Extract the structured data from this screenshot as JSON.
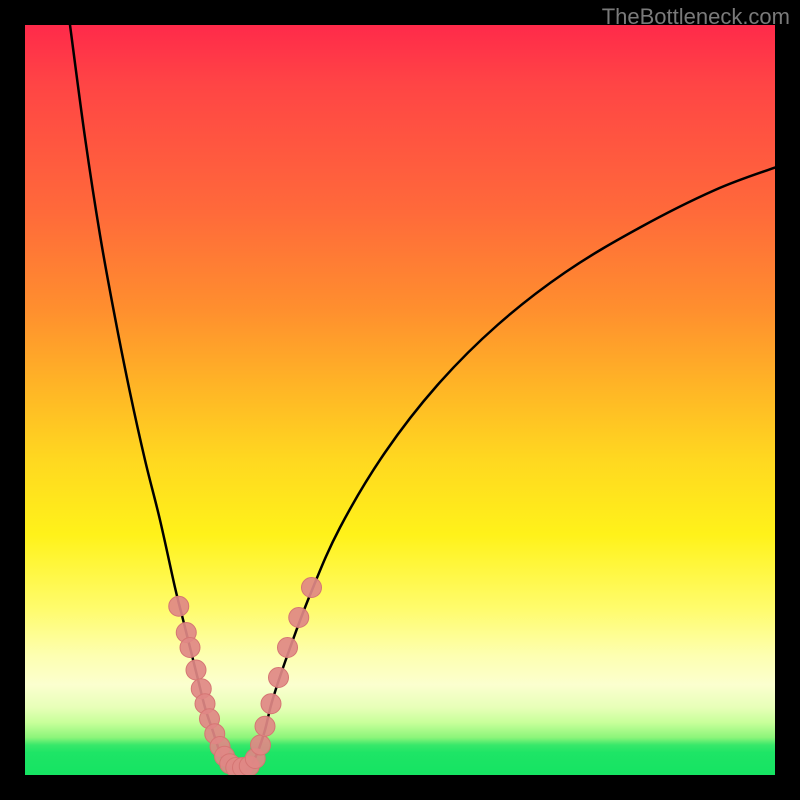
{
  "watermark": "TheBottleneck.com",
  "colors": {
    "frame": "#000000",
    "curve": "#000000",
    "marker_fill": "#e08886",
    "marker_stroke": "#d57573"
  },
  "chart_data": {
    "type": "line",
    "title": "",
    "xlabel": "",
    "ylabel": "",
    "xlim": [
      0,
      100
    ],
    "ylim": [
      0,
      100
    ],
    "series": [
      {
        "name": "left-branch",
        "x": [
          6,
          8,
          10,
          12,
          14,
          16,
          18,
          20,
          21,
          22,
          23,
          24,
          25,
          26,
          27
        ],
        "y": [
          100,
          85,
          72,
          61,
          51,
          42,
          34,
          25,
          21,
          17,
          13,
          9,
          6,
          3,
          1
        ]
      },
      {
        "name": "right-branch",
        "x": [
          30,
          31,
          32,
          33,
          35,
          38,
          42,
          48,
          55,
          63,
          72,
          82,
          92,
          100
        ],
        "y": [
          1,
          3,
          6,
          10,
          16,
          24,
          33,
          43,
          52,
          60,
          67,
          73,
          78,
          81
        ]
      },
      {
        "name": "valley-floor",
        "x": [
          27,
          28,
          29,
          30
        ],
        "y": [
          1,
          0.5,
          0.5,
          1
        ]
      }
    ],
    "markers": {
      "name": "highlight-points",
      "x": [
        20.5,
        21.5,
        22.0,
        22.8,
        23.5,
        24.0,
        24.6,
        25.3,
        26.0,
        26.6,
        27.3,
        28.1,
        29.0,
        29.9,
        30.7,
        31.4,
        32.0,
        32.8,
        33.8,
        35.0,
        36.5,
        38.2
      ],
      "y": [
        22.5,
        19.0,
        17.0,
        14.0,
        11.5,
        9.5,
        7.5,
        5.5,
        3.8,
        2.5,
        1.5,
        1.0,
        1.0,
        1.2,
        2.2,
        4.0,
        6.5,
        9.5,
        13.0,
        17.0,
        21.0,
        25.0
      ]
    }
  }
}
